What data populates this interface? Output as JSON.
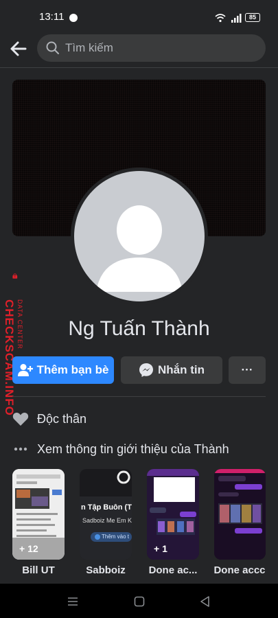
{
  "status_bar": {
    "time": "13:11",
    "battery": "85"
  },
  "search": {
    "placeholder": "Tìm kiếm"
  },
  "profile": {
    "name": "Ng Tuấn Thành"
  },
  "actions": {
    "add_friend": "Thêm bạn bè",
    "message": "Nhắn tin",
    "more": "···"
  },
  "info": {
    "relationship": "Độc thân",
    "about_link": "Xem thông tin giới thiệu của Thành"
  },
  "stories": [
    {
      "label": "Bill UT",
      "count": "+ 12"
    },
    {
      "label": "Sabboiz",
      "count": "",
      "overlay_title": "n Tập Buôn (Trun",
      "overlay_sub": "Sadboiz Me Em Ko Me",
      "overlay_btn": "Thêm vào t"
    },
    {
      "label": "Done ac...",
      "count": "+ 1"
    },
    {
      "label": "Done accc",
      "count": ""
    }
  ],
  "watermark": {
    "main": "CHECKSCAM.INFO",
    "sub": "DATA CENTER"
  },
  "colors": {
    "accent": "#2d88ff",
    "background": "#242527",
    "surface": "#3a3b3c",
    "watermark": "#e0202a"
  }
}
